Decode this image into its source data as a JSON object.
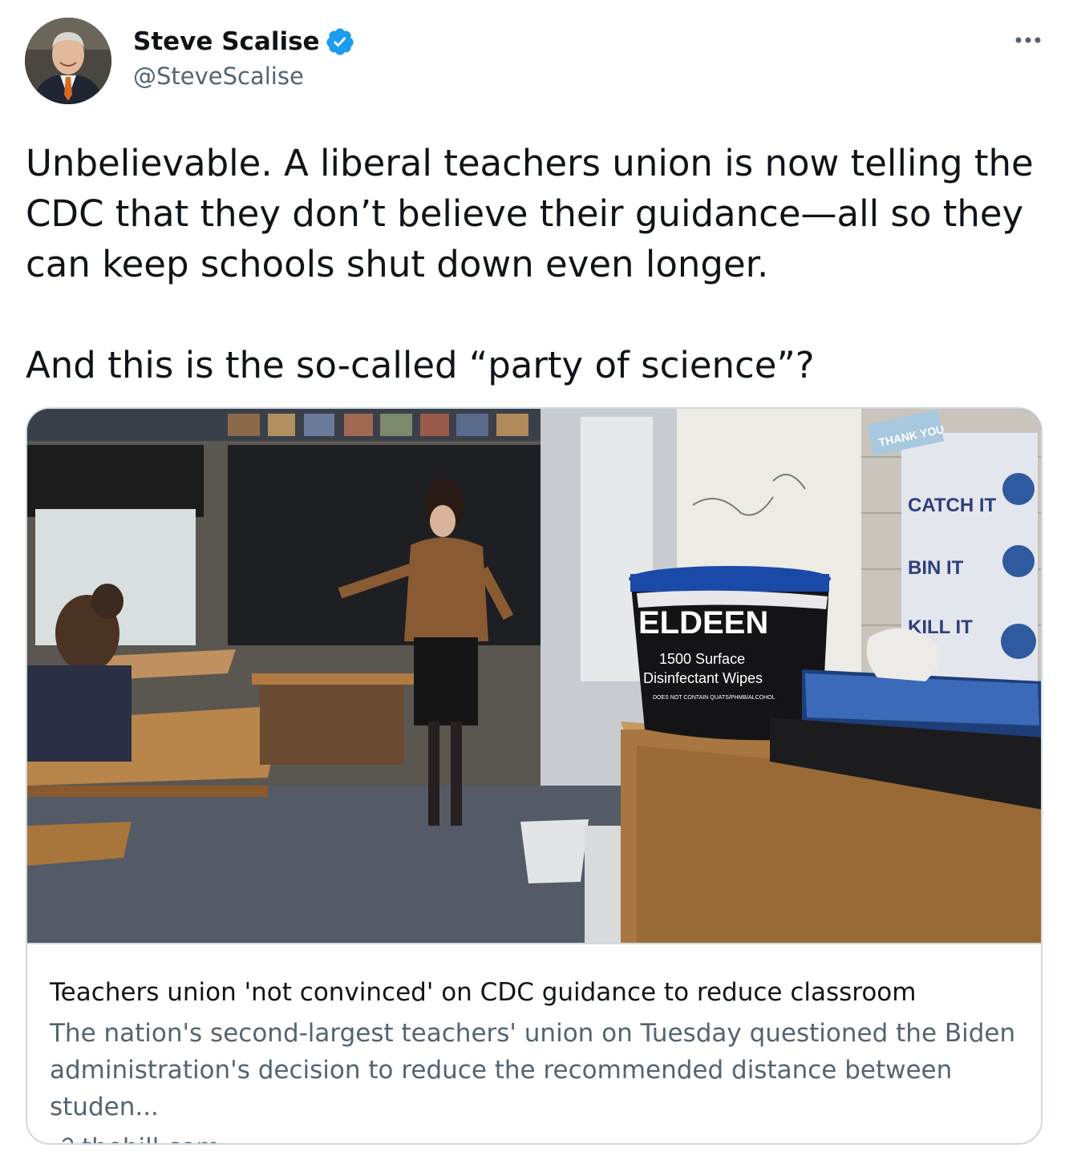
{
  "author": {
    "display_name": "Steve Scalise",
    "handle": "@SteveScalise",
    "avatar_icon": "profile-photo",
    "verified_icon": "verified-badge-icon",
    "verified_color": "#1d9bf0"
  },
  "tweet": {
    "text": "Unbelievable. A liberal teachers union is now telling the CDC that they don’t believe their guidance—all so they can keep schools shut down even longer.\n\nAnd this is the so-called “party of science”?"
  },
  "link_card": {
    "image_texts": {
      "bucket_brand": "ELDEEN",
      "bucket_line1": "1500 Surface",
      "bucket_line2": "Disinfectant Wipes",
      "bucket_line3": "DOES NOT CONTAIN QUATS/PHMB/ALCOHOL",
      "poster_line1": "CATCH IT",
      "poster_line2": "BIN IT",
      "poster_line3": "KILL IT",
      "banner": "THANK YOU"
    },
    "title": "Teachers union 'not convinced' on CDC guidance to reduce classroom",
    "description": "The nation's second-largest teachers' union on Tuesday questioned the Biden administration's decision to reduce the recommended distance between studen...",
    "domain": "thehill.com",
    "domain_icon": "link-icon"
  },
  "menu": {
    "more_icon": "more-options-icon"
  },
  "colors": {
    "text_primary": "#0f1419",
    "text_secondary": "#536471",
    "border": "#cfd9de"
  }
}
